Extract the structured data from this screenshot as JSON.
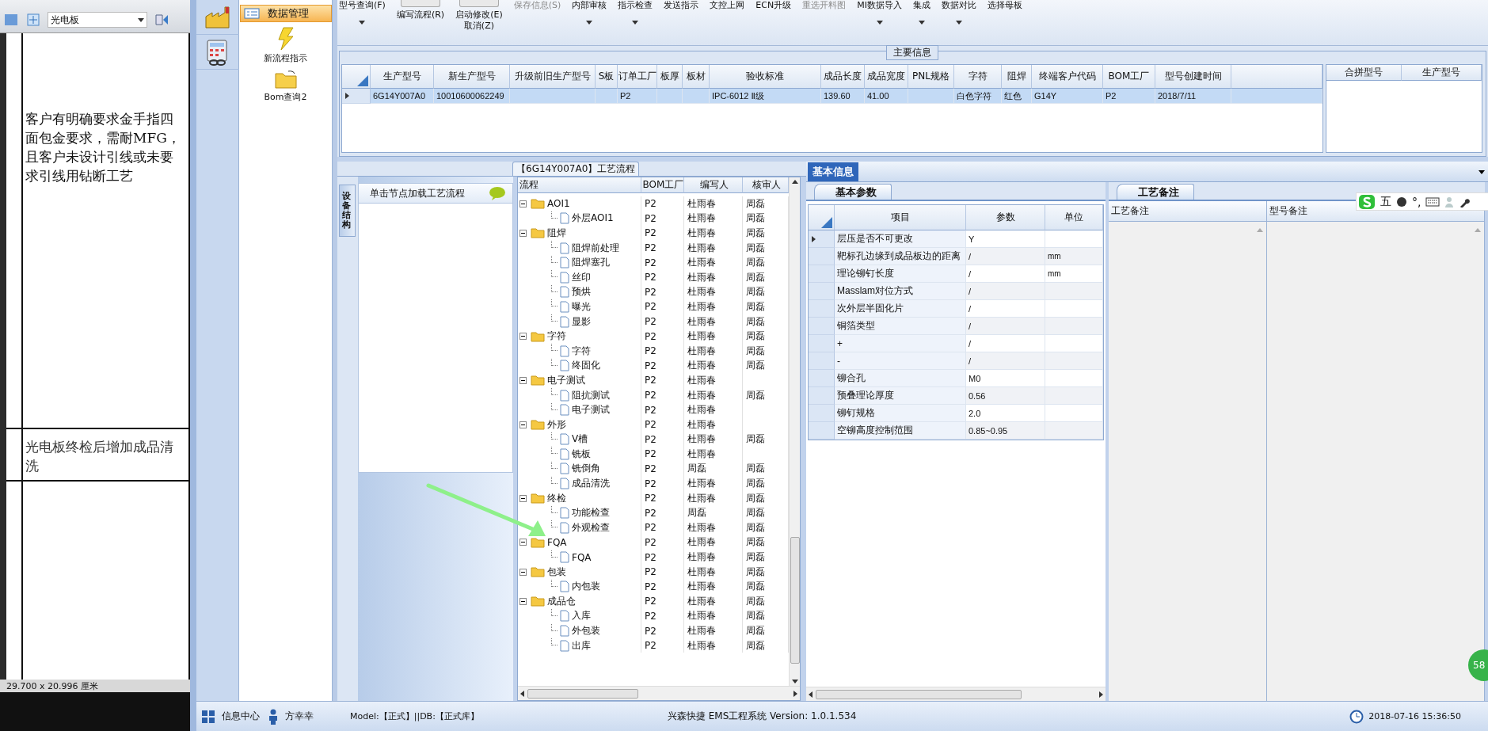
{
  "doc_viewer": {
    "zoom_combo": "光电板",
    "cells": [
      "客户有明确要求金手指四面包金要求，需耐MFG，且客户未设计引线或未要求引线用钻断工艺",
      "光电板终检后增加成品清洗"
    ],
    "page_size": "29.700 x 20.996 厘米"
  },
  "nav": {
    "header": "数据管理",
    "items": [
      {
        "label": "新流程指示",
        "kind": "lightning"
      },
      {
        "label": "Bom查询2",
        "kind": "folder"
      }
    ]
  },
  "toolbar": [
    {
      "label": "型号查询(F)",
      "kind": "text",
      "dropdown": true,
      "disabled": false
    },
    {
      "label": "编写流程(R)",
      "kind": "icon",
      "dropdown": false,
      "disabled": false
    },
    {
      "label": "启动修改(E)",
      "sub": "取消(Z)",
      "kind": "icon",
      "dropdown": false,
      "disabled": false
    },
    {
      "label": "保存信息(S)",
      "kind": "text",
      "dropdown": false,
      "disabled": true
    },
    {
      "label": "内部审核",
      "kind": "text",
      "dropdown": true,
      "disabled": false
    },
    {
      "label": "指示检查",
      "kind": "text",
      "dropdown": true,
      "disabled": false
    },
    {
      "label": "发送指示",
      "kind": "text",
      "dropdown": false,
      "disabled": false
    },
    {
      "label": "文控上网",
      "kind": "text",
      "dropdown": false,
      "disabled": false
    },
    {
      "label": "ECN升级",
      "kind": "text",
      "dropdown": false,
      "disabled": false
    },
    {
      "label": "重选开料图",
      "kind": "text",
      "dropdown": false,
      "disabled": true
    },
    {
      "label": "MI数据导入",
      "kind": "text",
      "dropdown": true,
      "disabled": false
    },
    {
      "label": "集成",
      "kind": "text",
      "dropdown": true,
      "disabled": false
    },
    {
      "label": "数据对比",
      "kind": "text",
      "dropdown": true,
      "disabled": false
    },
    {
      "label": "选择母板",
      "kind": "text",
      "dropdown": false,
      "disabled": false
    }
  ],
  "main_info": {
    "title": "主要信息",
    "columns": [
      "生产型号",
      "新生产型号",
      "升级前旧生产型号",
      "S板",
      "订单工厂",
      "板厚",
      "板材",
      "验收标准",
      "成品长度",
      "成品宽度",
      "PNL规格",
      "字符",
      "阻焊",
      "终端客户代码",
      "BOM工厂",
      "型号创建时间"
    ],
    "rows": [
      {
        "selected": true,
        "cells": [
          "6G14Y007A0",
          "10010600062249",
          null,
          null,
          "P2",
          null,
          null,
          "IPC-6012 Ⅱ级",
          "139.60",
          "41.00",
          null,
          "白色字符",
          "红色",
          "G14Y",
          "P2",
          "2018/7/11"
        ]
      }
    ],
    "side_columns": [
      "合拼型号",
      "生产型号"
    ]
  },
  "process": {
    "tab": "【6G14Y007A0】工艺流程",
    "side_tab": "设备结构",
    "hint": "单击节点加载工艺流程",
    "columns": [
      "流程",
      "BOM工厂",
      "编写人",
      "核审人"
    ],
    "tree": [
      {
        "name": "AOI1",
        "bom": "P2",
        "writer": "杜雨春",
        "reviewer": "周磊",
        "expanded": true,
        "children": [
          {
            "name": "外层AOI1",
            "bom": "P2",
            "writer": "杜雨春",
            "reviewer": "周磊"
          }
        ]
      },
      {
        "name": "阻焊",
        "bom": "P2",
        "writer": "杜雨春",
        "reviewer": "周磊",
        "expanded": true,
        "children": [
          {
            "name": "阻焊前处理",
            "bom": "P2",
            "writer": "杜雨春",
            "reviewer": "周磊"
          },
          {
            "name": "阻焊塞孔",
            "bom": "P2",
            "writer": "杜雨春",
            "reviewer": "周磊"
          },
          {
            "name": "丝印",
            "bom": "P2",
            "writer": "杜雨春",
            "reviewer": "周磊"
          },
          {
            "name": "预烘",
            "bom": "P2",
            "writer": "杜雨春",
            "reviewer": "周磊"
          },
          {
            "name": "曝光",
            "bom": "P2",
            "writer": "杜雨春",
            "reviewer": "周磊"
          },
          {
            "name": "显影",
            "bom": "P2",
            "writer": "杜雨春",
            "reviewer": "周磊"
          }
        ]
      },
      {
        "name": "字符",
        "bom": "P2",
        "writer": "杜雨春",
        "reviewer": "周磊",
        "expanded": true,
        "children": [
          {
            "name": "字符",
            "bom": "P2",
            "writer": "杜雨春",
            "reviewer": "周磊"
          },
          {
            "name": "终固化",
            "bom": "P2",
            "writer": "杜雨春",
            "reviewer": "周磊"
          }
        ]
      },
      {
        "name": "电子测试",
        "bom": "P2",
        "writer": "杜雨春",
        "expanded": true,
        "children": [
          {
            "name": "阻抗测试",
            "bom": "P2",
            "writer": "杜雨春",
            "reviewer": "周磊"
          },
          {
            "name": "电子测试",
            "bom": "P2",
            "writer": "杜雨春"
          }
        ]
      },
      {
        "name": "外形",
        "bom": "P2",
        "writer": "杜雨春",
        "expanded": true,
        "children": [
          {
            "name": "V槽",
            "bom": "P2",
            "writer": "杜雨春",
            "reviewer": "周磊"
          },
          {
            "name": "铣板",
            "bom": "P2",
            "writer": "杜雨春"
          },
          {
            "name": "铣倒角",
            "bom": "P2",
            "writer": "周磊",
            "reviewer": "周磊"
          },
          {
            "name": "成品清洗",
            "bom": "P2",
            "writer": "杜雨春",
            "reviewer": "周磊"
          }
        ]
      },
      {
        "name": "终检",
        "bom": "P2",
        "writer": "杜雨春",
        "reviewer": "周磊",
        "expanded": true,
        "children": [
          {
            "name": "功能检查",
            "bom": "P2",
            "writer": "周磊",
            "reviewer": "周磊"
          },
          {
            "name": "外观检查",
            "bom": "P2",
            "writer": "杜雨春",
            "reviewer": "周磊"
          }
        ]
      },
      {
        "name": "FQA",
        "bom": "P2",
        "writer": "杜雨春",
        "reviewer": "周磊",
        "expanded": true,
        "children": [
          {
            "name": "FQA",
            "bom": "P2",
            "writer": "杜雨春",
            "reviewer": "周磊"
          }
        ]
      },
      {
        "name": "包装",
        "bom": "P2",
        "writer": "杜雨春",
        "reviewer": "周磊",
        "expanded": true,
        "children": [
          {
            "name": "内包装",
            "bom": "P2",
            "writer": "杜雨春",
            "reviewer": "周磊"
          }
        ]
      },
      {
        "name": "成品仓",
        "bom": "P2",
        "writer": "杜雨春",
        "reviewer": "周磊",
        "expanded": true,
        "children": [
          {
            "name": "入库",
            "bom": "P2",
            "writer": "杜雨春",
            "reviewer": "周磊"
          },
          {
            "name": "外包装",
            "bom": "P2",
            "writer": "杜雨春",
            "reviewer": "周磊"
          },
          {
            "name": "出库",
            "bom": "P2",
            "writer": "杜雨春",
            "reviewer": "周磊"
          }
        ]
      }
    ]
  },
  "basic_info": {
    "tab": "基本信息",
    "params_tab": "基本参数",
    "columns": [
      "项目",
      "参数",
      "单位"
    ],
    "rows": [
      {
        "item": "层压是否不可更改",
        "value": "Y",
        "selected": true
      },
      {
        "item": "靶标孔边缘到成品板边的距离",
        "value": "/",
        "unit": "mm",
        "selected": false
      },
      {
        "item": "理论铆钉长度",
        "value": "/",
        "unit": "mm",
        "selected": false
      },
      {
        "item": "Masslam对位方式",
        "value": "/",
        "selected": false
      },
      {
        "item": "次外层半固化片",
        "value": "/",
        "selected": false
      },
      {
        "item": "铜箔类型",
        "value": "/",
        "selected": false
      },
      {
        "item": "+",
        "value": "/",
        "selected": false
      },
      {
        "item": "-",
        "value": "/",
        "selected": false
      },
      {
        "item": "铆合孔",
        "value": "M0",
        "selected": false
      },
      {
        "item": "预叠理论厚度",
        "value": "0.56",
        "selected": false
      },
      {
        "item": "铆钉规格",
        "value": "2.0",
        "selected": false
      },
      {
        "item": "空铆高度控制范围",
        "value": "0.85~0.95",
        "selected": false
      }
    ]
  },
  "remarks": {
    "tab": "工艺备注",
    "columns": [
      "工艺备注",
      "型号备注"
    ]
  },
  "ime_bar": {
    "mode": "五",
    "punct": "°,"
  },
  "badge": "58",
  "status_bar": {
    "info_center": "信息中心",
    "user": "方幸幸",
    "env": "Model:【正式】||DB:【正式库】",
    "app": "兴森快捷 EMS工程系统 Version: 1.0.1.534",
    "clock": "2018-07-16 15:36:50"
  }
}
